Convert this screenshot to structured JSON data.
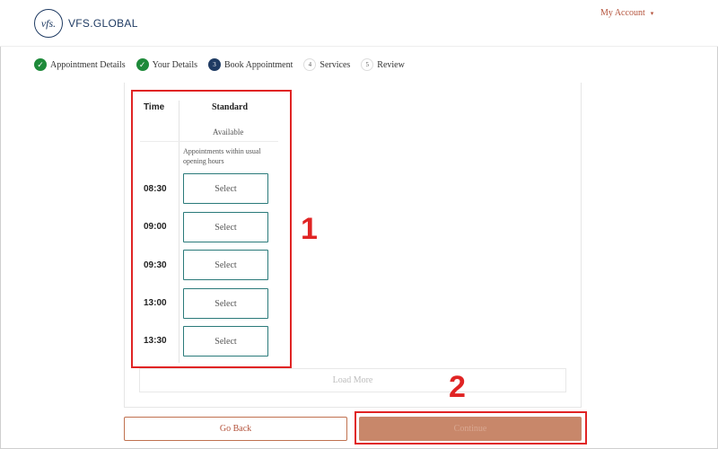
{
  "header": {
    "logo_mark": "vfs.",
    "logo_text": "VFS.GLOBAL",
    "account_label": "My Account",
    "account_caret": "▾"
  },
  "stepper": [
    {
      "label": "Appointment Details",
      "state": "done",
      "marker": "✓"
    },
    {
      "label": "Your Details",
      "state": "done",
      "marker": "✓"
    },
    {
      "label": "Book Appointment",
      "state": "active",
      "marker": "3"
    },
    {
      "label": "Services",
      "state": "pending",
      "marker": "4"
    },
    {
      "label": "Review",
      "state": "pending",
      "marker": "5"
    }
  ],
  "table": {
    "time_header": "Time",
    "standard_header": "Standard",
    "available_label": "Available",
    "note": "Appointments within usual opening hours",
    "slots": [
      {
        "time": "08:30",
        "button": "Select"
      },
      {
        "time": "09:00",
        "button": "Select"
      },
      {
        "time": "09:30",
        "button": "Select"
      },
      {
        "time": "13:00",
        "button": "Select"
      },
      {
        "time": "13:30",
        "button": "Select"
      }
    ],
    "load_more": "Load More"
  },
  "footer": {
    "go_back": "Go Back",
    "continue": "Continue"
  },
  "annotations": {
    "label_1": "1",
    "label_2": "2",
    "color": "#e02424"
  },
  "colors": {
    "brand_navy": "#1f3b63",
    "accent_terracotta": "#b4533c",
    "success_green": "#1e8a3a",
    "slot_border_teal": "#2a7a7a"
  }
}
